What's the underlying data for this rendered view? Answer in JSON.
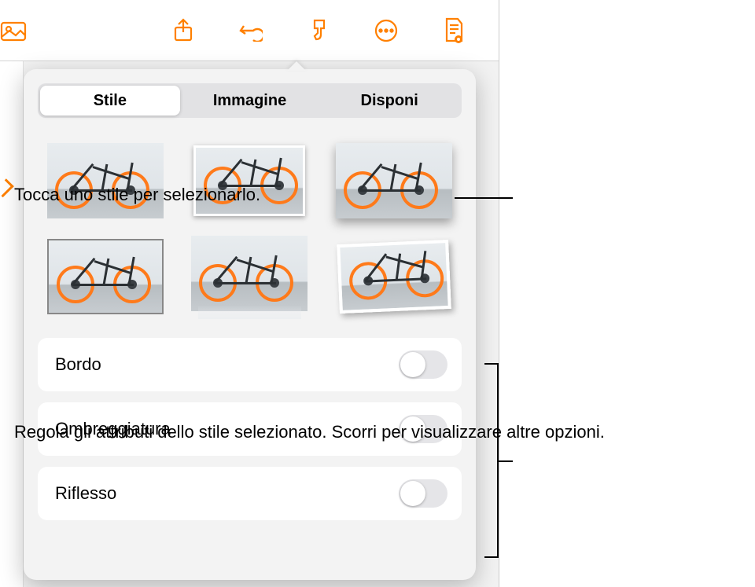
{
  "toolbar": {
    "icons": [
      "media-icon",
      "share-icon",
      "undo-icon",
      "format-brush-icon",
      "more-icon",
      "document-view-icon"
    ]
  },
  "tabs": {
    "style": "Stile",
    "image": "Immagine",
    "arrange": "Disponi"
  },
  "settings": {
    "border": {
      "label": "Bordo",
      "on": false
    },
    "shadow": {
      "label": "Ombreggiatura",
      "on": false
    },
    "reflection": {
      "label": "Riflesso",
      "on": false
    }
  },
  "callouts": {
    "style_tap": "Tocca uno stile per selezionarlo.",
    "attributes": "Regola gli attributi dello stile selezionato. Scorri per visualizzare altre opzioni."
  }
}
